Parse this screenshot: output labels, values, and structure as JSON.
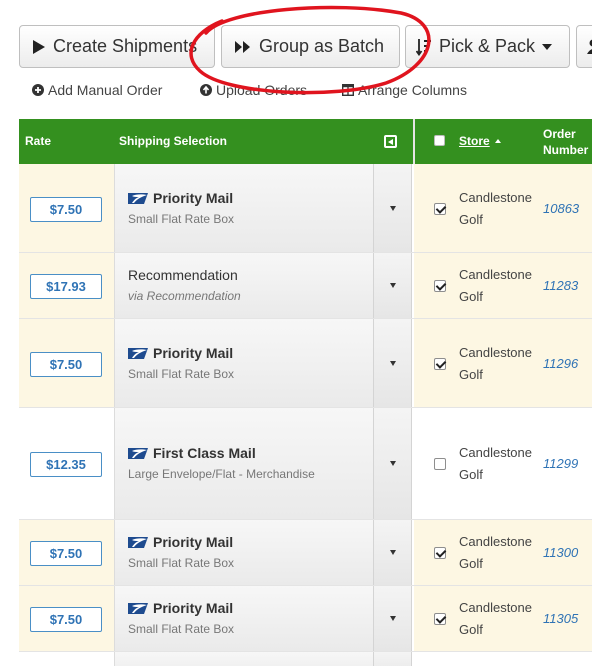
{
  "toolbar": {
    "create_label": "Create Shipments",
    "group_label": "Group as Batch",
    "pick_label": "Pick & Pack"
  },
  "actions": {
    "add_label": "Add Manual Order",
    "upload_label": "Upload Orders",
    "arrange_label": "Arrange Columns"
  },
  "table": {
    "headers": {
      "rate": "Rate",
      "shipping": "Shipping Selection",
      "store": "Store",
      "order_line1": "Order",
      "order_line2": "Number"
    },
    "rows": [
      {
        "rate": "$7.50",
        "service": "Priority Mail",
        "detail": "Small Flat Rate Box",
        "usps": true,
        "checked": true,
        "store": "Candlestone Golf",
        "order": "10863"
      },
      {
        "rate": "$17.93",
        "service": "Recommendation",
        "detail": "via Recommendation",
        "usps": false,
        "checked": true,
        "store": "Candlestone Golf",
        "order": "11283"
      },
      {
        "rate": "$7.50",
        "service": "Priority Mail",
        "detail": "Small Flat Rate Box",
        "usps": true,
        "checked": true,
        "store": "Candlestone Golf",
        "order": "11296"
      },
      {
        "rate": "$12.35",
        "service": "First Class Mail",
        "detail": "Large Envelope/Flat - Merchandise",
        "usps": true,
        "checked": false,
        "store": "Candlestone Golf",
        "order": "11299"
      },
      {
        "rate": "$7.50",
        "service": "Priority Mail",
        "detail": "Small Flat Rate Box",
        "usps": true,
        "checked": true,
        "store": "Candlestone Golf",
        "order": "11300"
      },
      {
        "rate": "$7.50",
        "service": "Priority Mail",
        "detail": "Small Flat Rate Box",
        "usps": true,
        "checked": true,
        "store": "Candlestone Golf",
        "order": "11305"
      }
    ]
  },
  "colors": {
    "header_green": "#34901f",
    "selected_row": "#fdf7e3",
    "link_blue": "#2f73b5",
    "annotation_red": "#e0141e"
  },
  "icons": {
    "create": "play-icon",
    "group": "fast-forward-icon",
    "pick": "sort-list-icon",
    "add": "plus-circle-icon",
    "upload": "upload-circle-icon",
    "arrange": "columns-icon",
    "carrier": "usps-eagle-icon"
  }
}
